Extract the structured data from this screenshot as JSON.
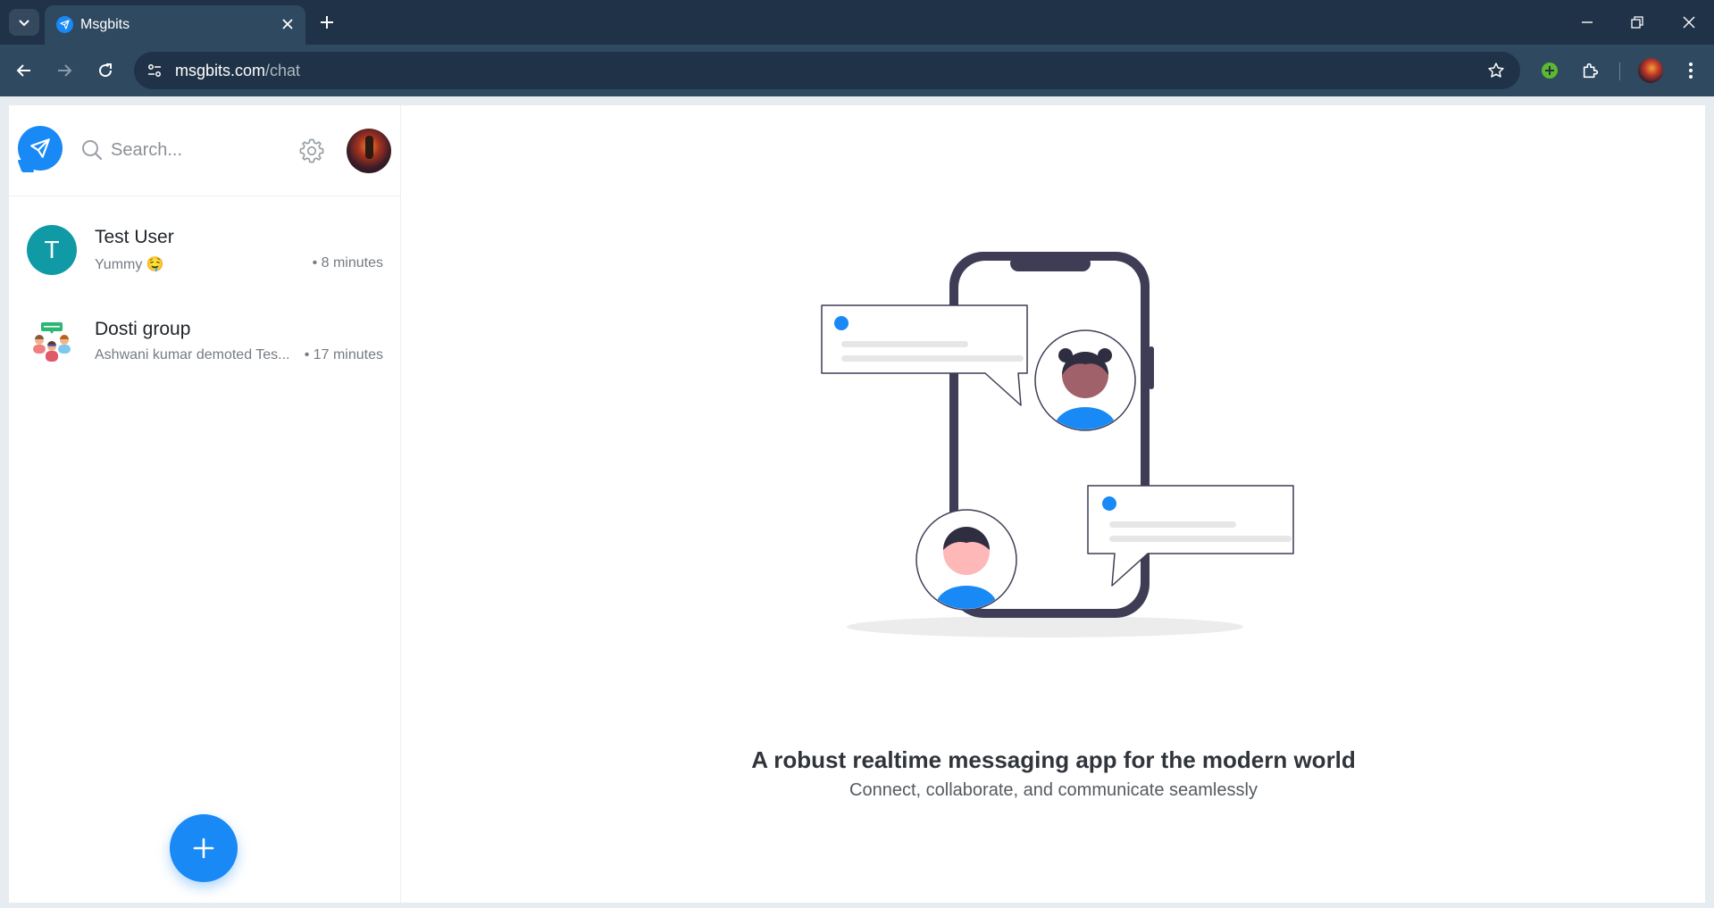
{
  "browser": {
    "tab_title": "Msgbits",
    "url_domain": "msgbits.com",
    "url_path": "/chat"
  },
  "sidebar": {
    "search_placeholder": "Search...",
    "chats": [
      {
        "name": "Test User",
        "avatar_letter": "T",
        "last_message": "Yummy 🤤",
        "time": "• 8 minutes"
      },
      {
        "name": "Dosti group",
        "avatar_letter": "",
        "last_message": "Ashwani kumar demoted Tes...",
        "time": "• 17 minutes"
      }
    ]
  },
  "main": {
    "headline": "A robust realtime messaging app for the modern world",
    "subline": "Connect, collaborate, and communicate seamlessly"
  },
  "colors": {
    "accent": "#1989f5",
    "chrome_dark": "#1f3247",
    "chrome_toolbar": "#2f4960"
  }
}
